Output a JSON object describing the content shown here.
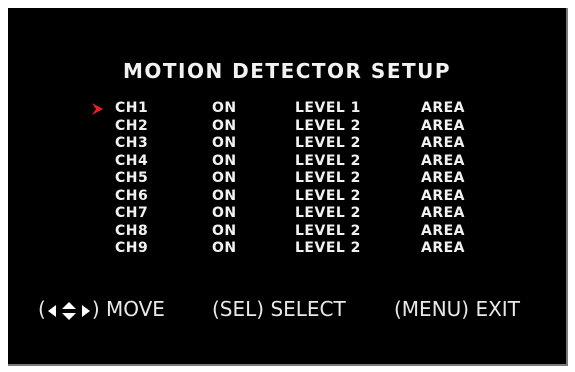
{
  "title": "MOTION DETECTOR SETUP",
  "selected_index": 0,
  "colors": {
    "background": "#000000",
    "text": "#f2f2f2",
    "cursor": "#e8202a"
  },
  "channels": [
    {
      "ch": "CH1",
      "state": "ON",
      "level": "LEVEL 1",
      "area": "AREA"
    },
    {
      "ch": "CH2",
      "state": "ON",
      "level": "LEVEL 2",
      "area": "AREA"
    },
    {
      "ch": "CH3",
      "state": "ON",
      "level": "LEVEL 2",
      "area": "AREA"
    },
    {
      "ch": "CH4",
      "state": "ON",
      "level": "LEVEL 2",
      "area": "AREA"
    },
    {
      "ch": "CH5",
      "state": "ON",
      "level": "LEVEL 2",
      "area": "AREA"
    },
    {
      "ch": "CH6",
      "state": "ON",
      "level": "LEVEL 2",
      "area": "AREA"
    },
    {
      "ch": "CH7",
      "state": "ON",
      "level": "LEVEL 2",
      "area": "AREA"
    },
    {
      "ch": "CH8",
      "state": "ON",
      "level": "LEVEL 2",
      "area": "AREA"
    },
    {
      "ch": "CH9",
      "state": "ON",
      "level": "LEVEL 2",
      "area": "AREA"
    }
  ],
  "footer": {
    "move_open": "(",
    "move_icon": "arrow-keys-icon",
    "move_label": ") MOVE",
    "select_label": "(SEL) SELECT",
    "exit_label": "(MENU) EXIT"
  }
}
